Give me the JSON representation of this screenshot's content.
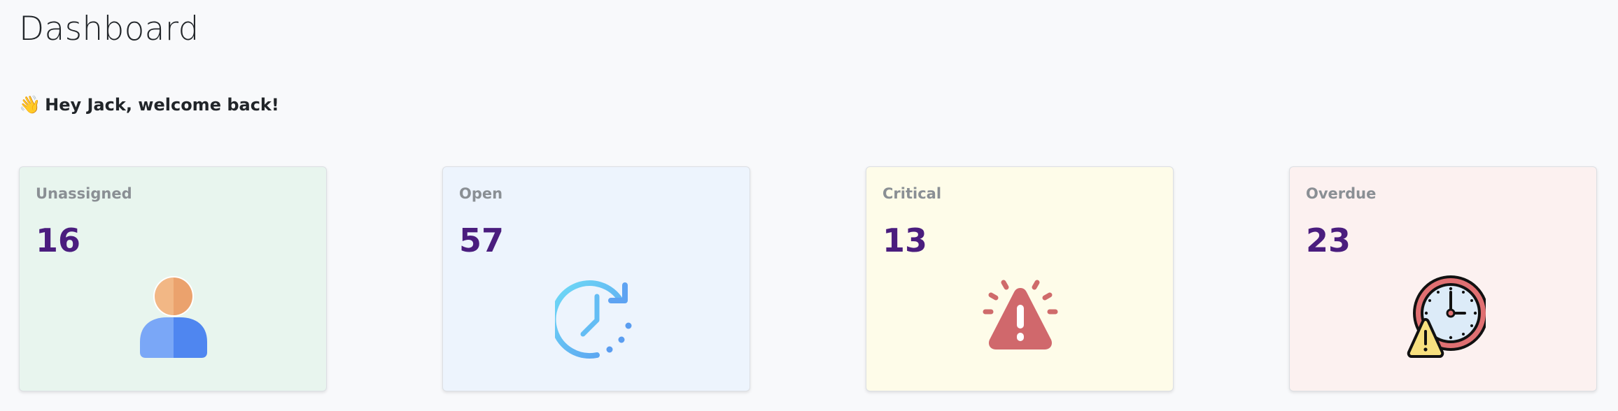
{
  "page": {
    "title": "Dashboard"
  },
  "welcome": {
    "emoji": "👋",
    "text": "Hey Jack, welcome back!"
  },
  "cards": [
    {
      "label": "Unassigned",
      "count": "16",
      "icon": "user-icon",
      "color": "#e8f5ee"
    },
    {
      "label": "Open",
      "count": "57",
      "icon": "clock-refresh-icon",
      "color": "#edf4fd"
    },
    {
      "label": "Critical",
      "count": "13",
      "icon": "alert-triangle-icon",
      "color": "#fefce9"
    },
    {
      "label": "Overdue",
      "count": "23",
      "icon": "clock-warning-icon",
      "color": "#fcf1f0"
    }
  ],
  "colors": {
    "count": "#4a1d7e",
    "label": "#8a8f94"
  }
}
